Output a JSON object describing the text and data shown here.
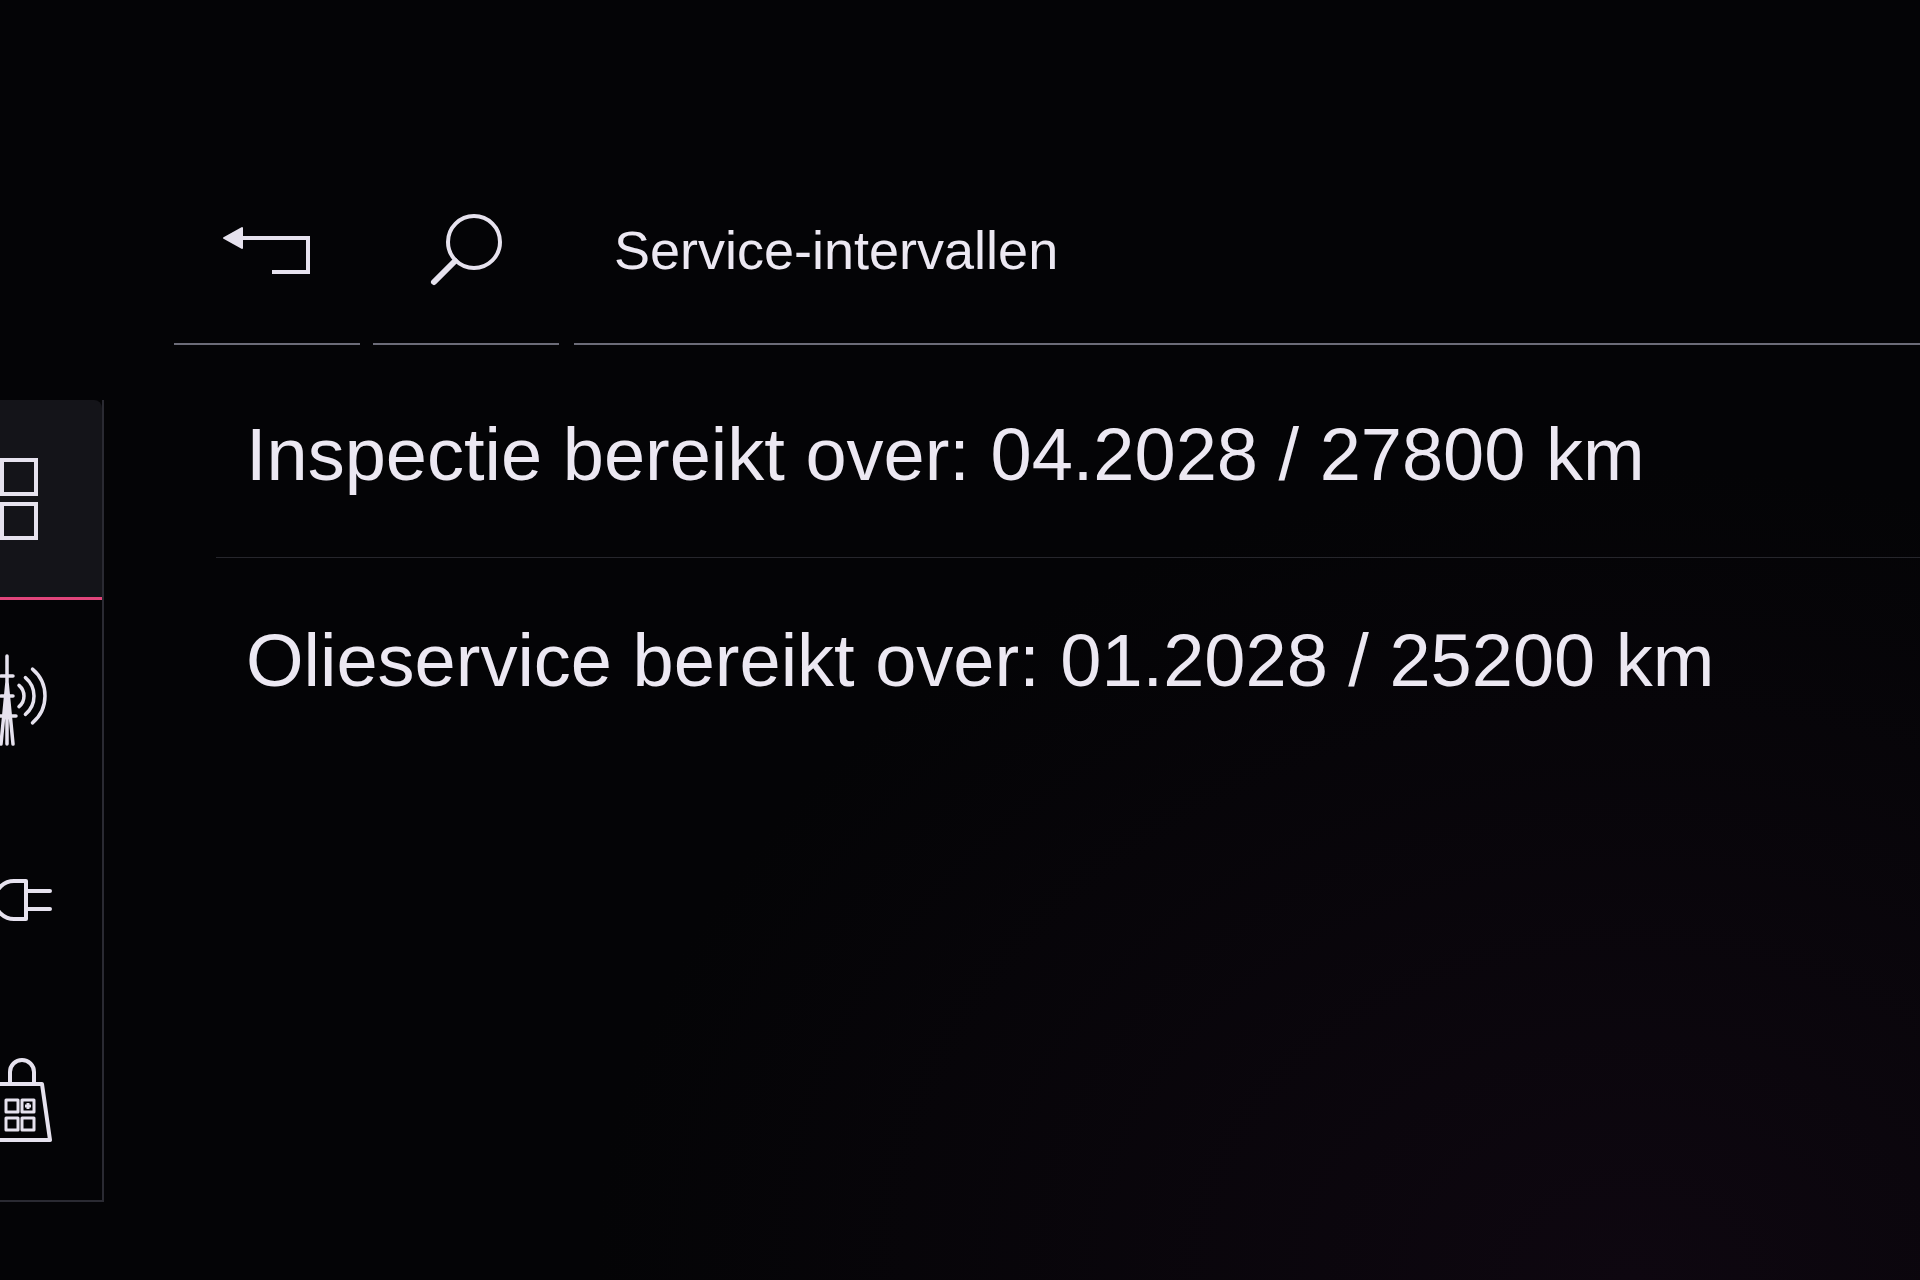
{
  "header": {
    "title": "Service-intervallen"
  },
  "sidebar": {
    "items": [
      {
        "kind": "grid",
        "selected": true
      },
      {
        "kind": "antenna",
        "selected": false
      },
      {
        "kind": "plug",
        "selected": false
      },
      {
        "kind": "bag",
        "selected": false
      }
    ]
  },
  "service_intervals": [
    {
      "text": "Inspectie bereikt over: 04.2028 / 27800 km"
    },
    {
      "text": "Olieservice bereikt over: 01.2028 / 25200 km"
    }
  ]
}
